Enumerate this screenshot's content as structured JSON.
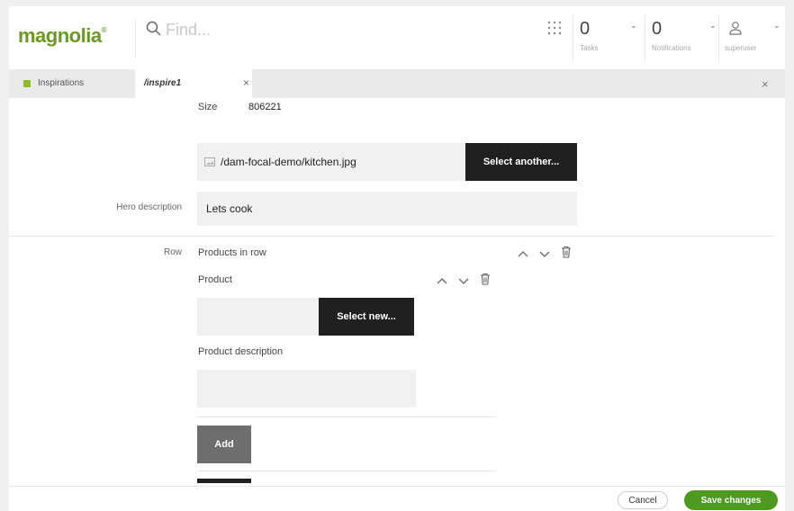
{
  "header": {
    "logo": "magnolia",
    "search_placeholder": "Find...",
    "tasks": {
      "count": "0",
      "label": "Tasks"
    },
    "notifications": {
      "count": "0",
      "label": "Notifications"
    },
    "user": {
      "label": "superuser"
    },
    "icons": {
      "search": "search-icon",
      "apps": "apps-grid-icon",
      "user": "user-icon",
      "caret": "chevron-down-icon"
    }
  },
  "tabs": {
    "items": [
      {
        "label": "Inspirations",
        "active": false,
        "color": "#8cbc2c"
      },
      {
        "label": "/inspire1",
        "active": true
      }
    ],
    "close_glyph": "×"
  },
  "form": {
    "size_label": "Size",
    "size_value": "806221",
    "image_path": "/dam-focal-demo/kitchen.jpg",
    "select_another": "Select another...",
    "hero_description_label": "Hero description",
    "hero_description_value": "Lets cook",
    "row_label": "Row",
    "products_in_row": "Products in row",
    "product_label": "Product",
    "select_new": "Select new...",
    "product_description_label": "Product description",
    "add_label": "Add"
  },
  "footer": {
    "cancel": "Cancel",
    "save": "Save changes",
    "accent": "#4e9a1f"
  }
}
